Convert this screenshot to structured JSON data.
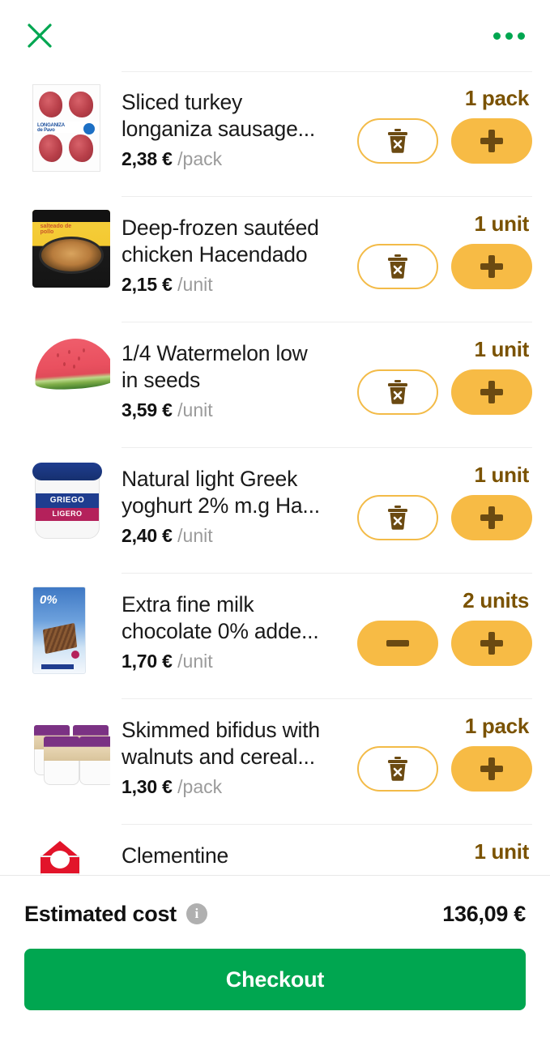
{
  "header": {
    "close_icon": "close-x-icon",
    "more_icon": "more-options-icon",
    "accent_color": "#00a650"
  },
  "cart": {
    "delete_label": "Delete item",
    "increase_label": "Increase quantity",
    "decrease_label": "Decrease quantity",
    "items": [
      {
        "name": "Sliced turkey longaniza sausage...",
        "price": "2,38 €",
        "unit": "/pack",
        "quantity_label": "1 pack",
        "control": "delete",
        "thumb": "sliced-turkey-longaniza-pack"
      },
      {
        "name": "Deep-frozen sautéed chicken Hacendado",
        "price": "2,15 €",
        "unit": "/unit",
        "quantity_label": "1 unit",
        "control": "delete",
        "thumb": "frozen-sauteed-chicken-bag"
      },
      {
        "name": "1/4 Watermelon low in seeds",
        "price": "3,59 €",
        "unit": "/unit",
        "quantity_label": "1 unit",
        "control": "delete",
        "thumb": "watermelon-wedge"
      },
      {
        "name": "Natural light Greek yoghurt 2% m.g Ha...",
        "price": "2,40 €",
        "unit": "/unit",
        "quantity_label": "1 unit",
        "control": "delete",
        "thumb": "greek-yoghurt-tub"
      },
      {
        "name": "Extra fine milk chocolate 0% adde...",
        "price": "1,70 €",
        "unit": "/unit",
        "quantity_label": "2 units",
        "control": "minus",
        "thumb": "milk-chocolate-bar"
      },
      {
        "name": "Skimmed bifidus with walnuts and cereal...",
        "price": "1,30 €",
        "unit": "/pack",
        "quantity_label": "1 pack",
        "control": "delete",
        "thumb": "bifidus-yoghurt-fourpack"
      },
      {
        "name": "Clementine",
        "price": "",
        "unit": "",
        "quantity_label": "1 unit",
        "control": "delete",
        "thumb": "milk-carton"
      }
    ]
  },
  "footer": {
    "total_label": "Estimated cost",
    "info_icon": "info-icon",
    "info_glyph": "i",
    "total_amount": "136,09 €",
    "checkout_label": "Checkout",
    "checkout_color": "#00a650"
  }
}
